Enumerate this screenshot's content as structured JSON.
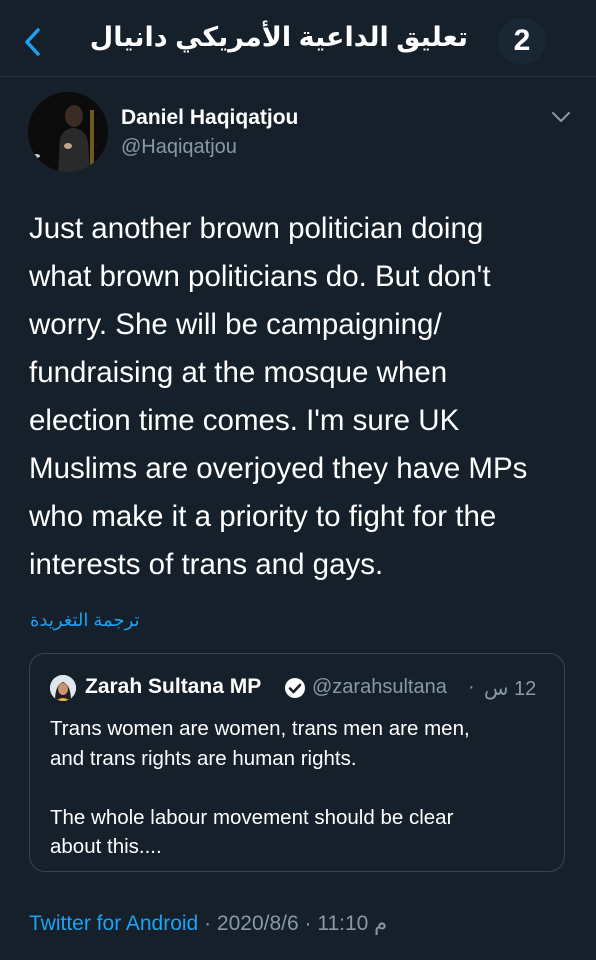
{
  "header": {
    "title": "تعليق الداعية الأمريكي دانيال",
    "count": "2",
    "back_icon": "chevron-left-icon"
  },
  "tweet": {
    "author_name": "Daniel Haqiqatjou",
    "author_handle": "@Haqiqatjou",
    "menu_icon": "chevron-down-icon",
    "lines": [
      "Just another brown politician doing",
      "what brown politicians do. But don't",
      "worry. She will be campaigning/",
      "fundraising at the mosque when",
      "election time comes. I'm sure UK",
      "Muslims are overjoyed they have MPs",
      "who make it a priority to fight for the",
      "interests of trans and gays."
    ],
    "translate_label": "ترجمة التغريدة"
  },
  "quote": {
    "name": "Zarah Sultana MP",
    "handle": "@zarahsultana",
    "separator": "·",
    "time": "12 س",
    "paragraph1": [
      "Trans women are women, trans men are men,",
      "and trans rights are human rights."
    ],
    "paragraph2": [
      "The whole labour movement should be clear",
      "about this...."
    ]
  },
  "footer": {
    "source": "Twitter for Android",
    "sep1": " · ",
    "date": "2020/8/6",
    "sep2": " · ",
    "time": "م 11:10"
  },
  "colors": {
    "background": "#15202b",
    "accent": "#1da1f2",
    "muted": "#8899a6",
    "border": "#38444d"
  }
}
